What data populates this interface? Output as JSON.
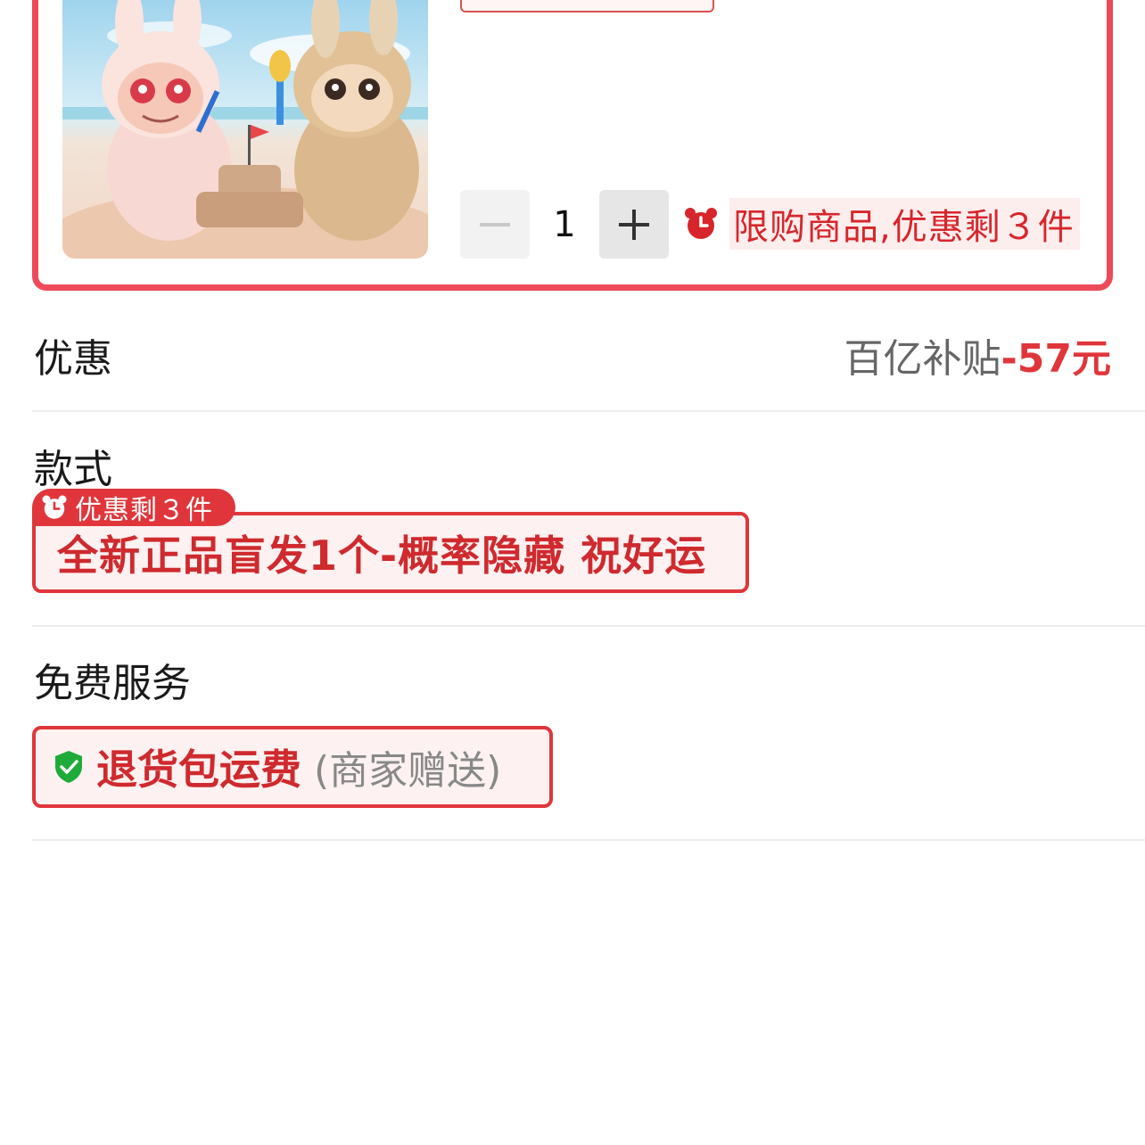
{
  "product": {
    "image_icon": "labubu-figures-on-beach-image",
    "partial_tag_label": "",
    "quantity": "1",
    "minus_label": "−",
    "plus_label": "+",
    "limit_notice": "限购商品,优惠剩３件"
  },
  "discount": {
    "label": "优惠",
    "source": "百亿补贴",
    "amount": "-57元"
  },
  "style": {
    "label": "款式",
    "badge": "优惠剩３件",
    "option": "全新正品盲发1个-概率隐藏 祝好运"
  },
  "service": {
    "label": "免费服务",
    "name": "退货包运费",
    "note": "(商家赠送)"
  },
  "colors": {
    "accent": "#e0363b",
    "card_border": "#ee4a5a",
    "shield_green": "#1fab3a"
  }
}
